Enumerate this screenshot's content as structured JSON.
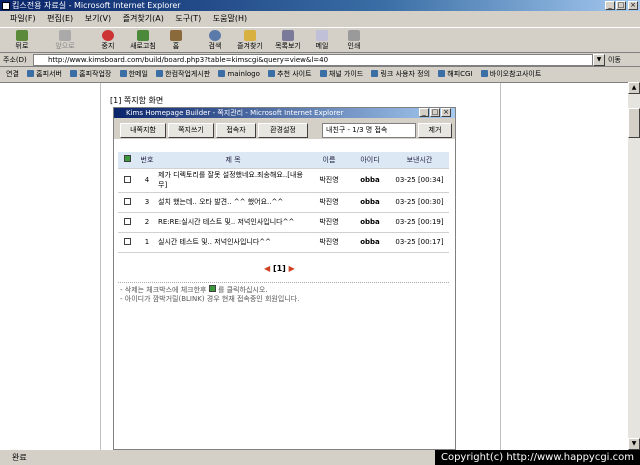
{
  "window": {
    "title": "킴스전용 자료실 - Microsoft Internet Explorer",
    "min": "_",
    "max": "□",
    "close": "×"
  },
  "menu": [
    "파일(F)",
    "편집(E)",
    "보기(V)",
    "즐겨찾기(A)",
    "도구(T)",
    "도움말(H)"
  ],
  "toolbar": [
    {
      "label": "뒤로",
      "icon": "back-arrow-icon"
    },
    {
      "label": "앞으로",
      "icon": "forward-arrow-icon"
    },
    {
      "label": "중지",
      "icon": "stop-icon"
    },
    {
      "label": "새로고침",
      "icon": "refresh-icon"
    },
    {
      "label": "홈",
      "icon": "home-icon"
    },
    {
      "label": "검색",
      "icon": "search-icon"
    },
    {
      "label": "즐겨찾기",
      "icon": "favorites-icon"
    },
    {
      "label": "목록보기",
      "icon": "history-icon"
    },
    {
      "label": "메일",
      "icon": "mail-icon"
    },
    {
      "label": "인쇄",
      "icon": "print-icon"
    }
  ],
  "address": {
    "label": "주소(D)",
    "url": "http://www.kimsboard.com/build/board.php3?table=kimscgi&query=view&l=40",
    "go": "이동"
  },
  "links": {
    "label": "연결",
    "items": [
      "홈피서버",
      "홈피작업장",
      "한메일",
      "한컴작업게시판",
      "mainlogo",
      "추천 사이트",
      "채널 가이드",
      "링크 사용자 정의",
      "해피CGI",
      "바이오참고사이트"
    ]
  },
  "page": {
    "caption": "[1] 쪽지함 화면"
  },
  "popup": {
    "title": "Kims Homepage Builder - 쪽지관리 - Microsoft Internet Explorer",
    "buttons": [
      "내쪽지함",
      "쪽지쓰기",
      "접속자",
      "환경설정"
    ],
    "select": "내친구 - 1/3 명 접속",
    "delete": "제거",
    "columns": [
      "번호",
      "제 목",
      "이름",
      "아이디",
      "보낸시간"
    ],
    "rows": [
      {
        "no": "4",
        "subject": "제가 디렉토리를 잘못 설정했네요.죄송해요..[내용무]",
        "name": "박진영",
        "id": "obba",
        "time": "03-25 [00:34]"
      },
      {
        "no": "3",
        "subject": "설치 했는데.. 오타 발견.. ^^ 했어요..^^",
        "name": "박진영",
        "id": "obba",
        "time": "03-25 [00:30]"
      },
      {
        "no": "2",
        "subject": "RE:RE:실시간 테스트 및.. 저넉인사입니다^^",
        "name": "박진영",
        "id": "obba",
        "time": "03-25 [00:19]"
      },
      {
        "no": "1",
        "subject": "실시간 테스트 및.. 저넉인사입니다^^",
        "name": "박진영",
        "id": "obba",
        "time": "03-25 [00:17]"
      }
    ],
    "pager": "[1]",
    "notes": [
      "- 삭제는 체크박스에 체크한후",
      "를 클릭하십시오.",
      "- 아이디가 깜박거릴(BLINK) 경우 현재 접속중인 회원입니다."
    ]
  },
  "status": {
    "text": "완료",
    "copyright": "Copyright(c) http://www.happycgi.com"
  }
}
